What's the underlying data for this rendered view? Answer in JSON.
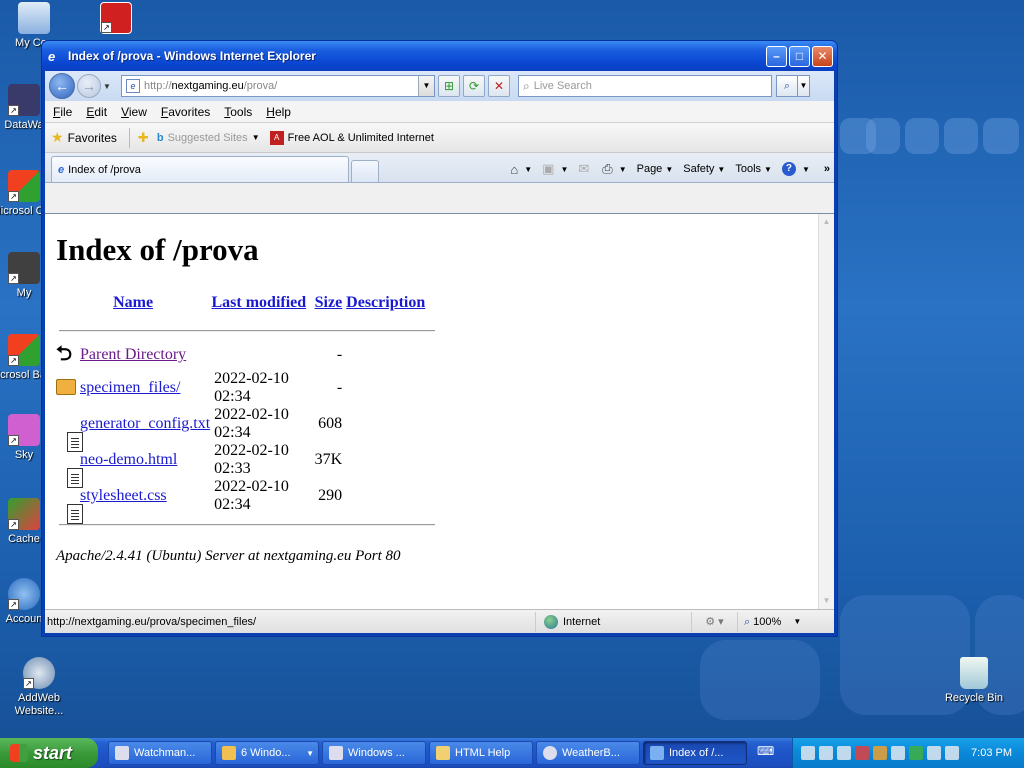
{
  "desktop": {
    "icons": [
      {
        "label": "My Con"
      },
      {
        "label": "DataWa"
      },
      {
        "label": "Microsol C++"
      },
      {
        "label": "My"
      },
      {
        "label": "Microsol Basic"
      },
      {
        "label": "Sky"
      },
      {
        "label": "Cache"
      },
      {
        "label": "Accoun"
      },
      {
        "label": "AddWeb Website..."
      },
      {
        "label": "Recycle Bin"
      }
    ]
  },
  "window": {
    "title": "Index of /prova - Windows Internet Explorer",
    "address": {
      "prefix": "http://",
      "host": "nextgaming.eu",
      "path": "/prova/"
    },
    "search_placeholder": "Live Search",
    "menu": [
      "File",
      "Edit",
      "View",
      "Favorites",
      "Tools",
      "Help"
    ],
    "favorites_bar": {
      "favorites_label": "Favorites",
      "suggested_sites": "Suggested Sites",
      "aol_link": "Free AOL & Unlimited Internet"
    },
    "tab_title": "Index of /prova",
    "command_bar": {
      "page": "Page",
      "safety": "Safety",
      "tools": "Tools"
    },
    "status": {
      "text": "http://nextgaming.eu/prova/specimen_files/",
      "zone": "Internet",
      "zoom": "100%"
    }
  },
  "page": {
    "heading": "Index of /prova",
    "columns": {
      "name": "Name",
      "modified": "Last modified",
      "size": "Size",
      "description": "Description"
    },
    "rows": [
      {
        "icon": "back",
        "name": "Parent Directory",
        "modified": "",
        "size": "-"
      },
      {
        "icon": "folder",
        "name": "specimen_files/",
        "modified": "2022-02-10 02:34",
        "size": "-"
      },
      {
        "icon": "doc",
        "name": "generator_config.txt",
        "modified": "2022-02-10 02:34",
        "size": "608"
      },
      {
        "icon": "doc",
        "name": "neo-demo.html",
        "modified": "2022-02-10 02:33",
        "size": "37K"
      },
      {
        "icon": "doc",
        "name": "stylesheet.css",
        "modified": "2022-02-10 02:34",
        "size": "290"
      }
    ],
    "server_signature": "Apache/2.4.41 (Ubuntu) Server at nextgaming.eu Port 80"
  },
  "taskbar": {
    "start_label": "start",
    "tasks": [
      {
        "label": "Watchman..."
      },
      {
        "label": "6 Windo..."
      },
      {
        "label": "Windows ..."
      },
      {
        "label": "HTML Help"
      },
      {
        "label": "WeatherB..."
      },
      {
        "label": "Index of /..."
      }
    ],
    "clock": "7:03 PM"
  }
}
